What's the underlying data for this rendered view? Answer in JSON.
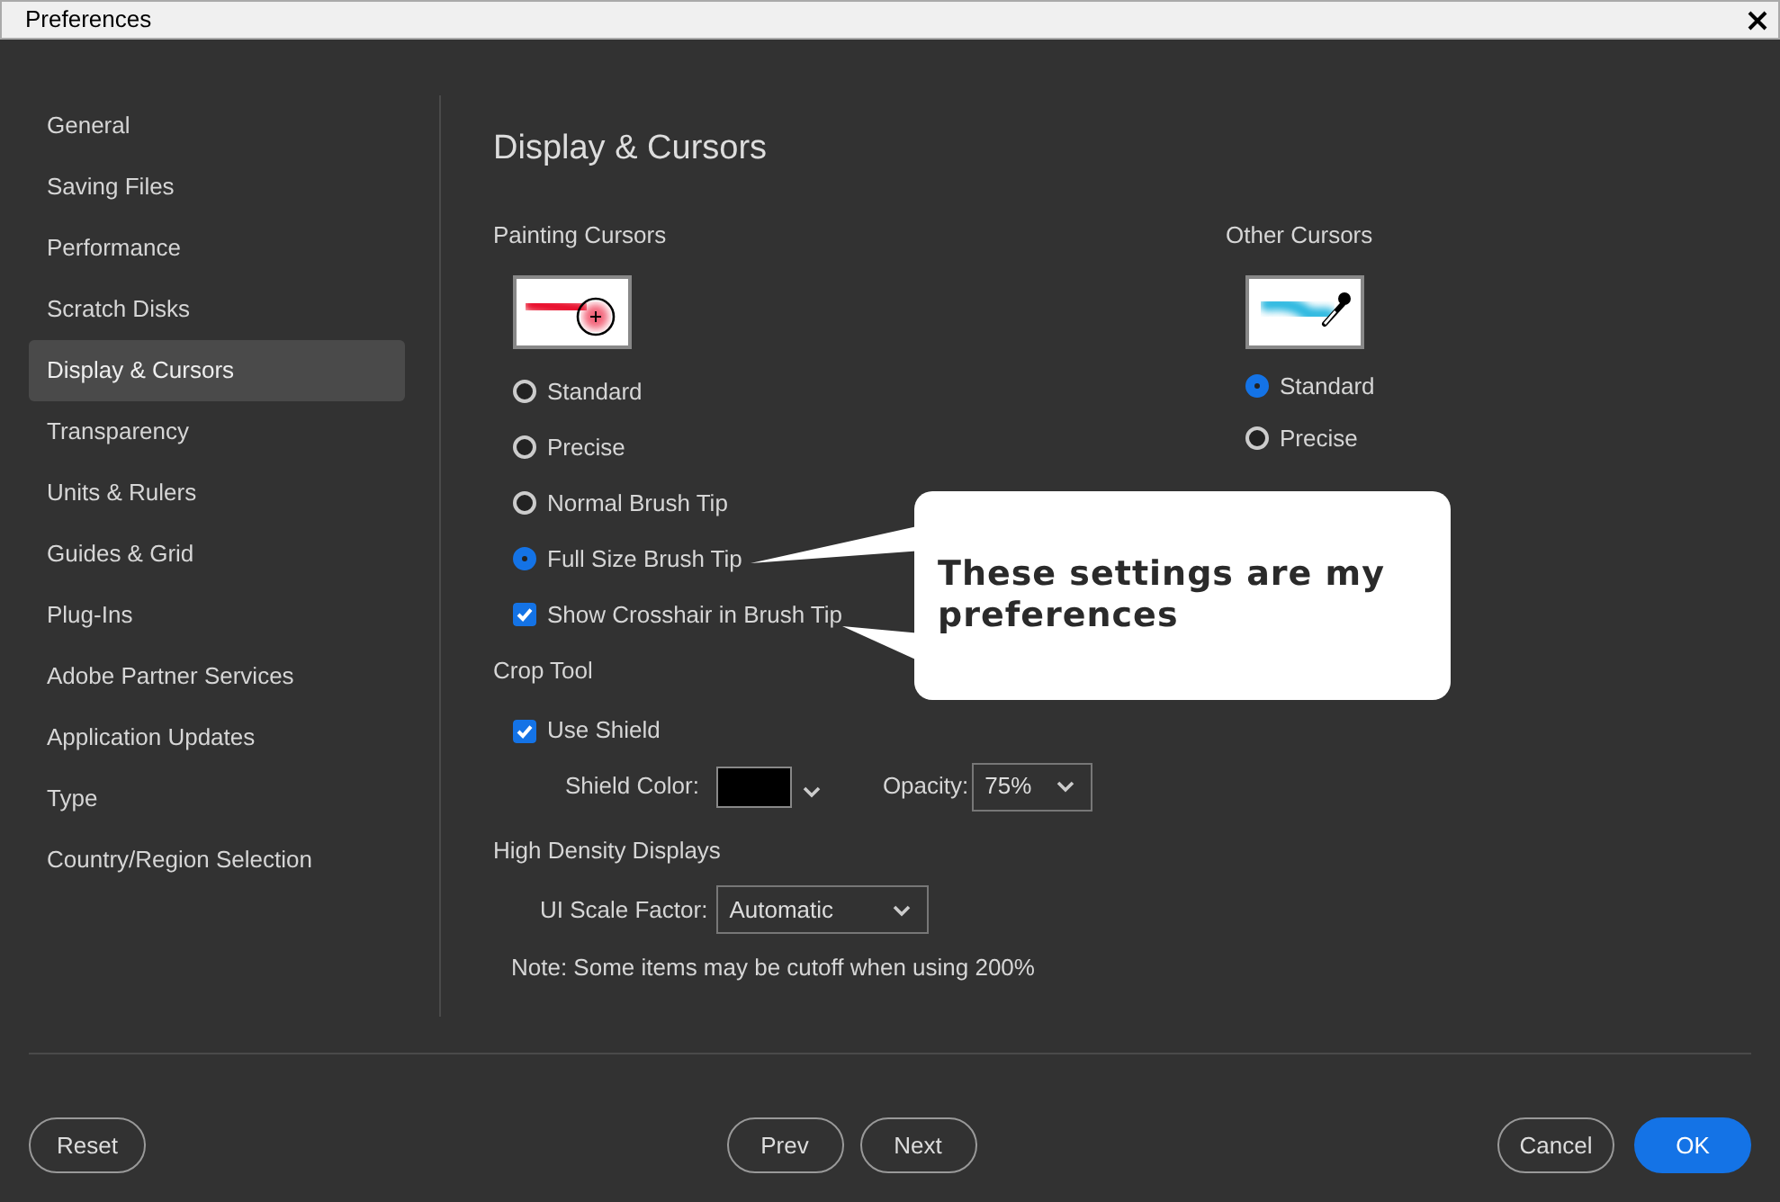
{
  "window": {
    "title": "Preferences"
  },
  "sidebar": {
    "items": [
      {
        "label": "General",
        "selected": false
      },
      {
        "label": "Saving Files",
        "selected": false
      },
      {
        "label": "Performance",
        "selected": false
      },
      {
        "label": "Scratch Disks",
        "selected": false
      },
      {
        "label": "Display & Cursors",
        "selected": true
      },
      {
        "label": "Transparency",
        "selected": false
      },
      {
        "label": "Units & Rulers",
        "selected": false
      },
      {
        "label": "Guides & Grid",
        "selected": false
      },
      {
        "label": "Plug-Ins",
        "selected": false
      },
      {
        "label": "Adobe Partner Services",
        "selected": false
      },
      {
        "label": "Application Updates",
        "selected": false
      },
      {
        "label": "Type",
        "selected": false
      },
      {
        "label": "Country/Region Selection",
        "selected": false
      }
    ]
  },
  "page_title": "Display & Cursors",
  "painting_cursors": {
    "label": "Painting Cursors",
    "options": [
      {
        "label": "Standard",
        "selected": false
      },
      {
        "label": "Precise",
        "selected": false
      },
      {
        "label": "Normal Brush Tip",
        "selected": false
      },
      {
        "label": "Full Size Brush Tip",
        "selected": true
      }
    ],
    "show_crosshair": {
      "label": "Show Crosshair in Brush Tip",
      "checked": true
    }
  },
  "other_cursors": {
    "label": "Other Cursors",
    "options": [
      {
        "label": "Standard",
        "selected": true
      },
      {
        "label": "Precise",
        "selected": false
      }
    ]
  },
  "crop_tool": {
    "label": "Crop Tool",
    "use_shield": {
      "label": "Use Shield",
      "checked": true
    },
    "shield_color": {
      "label": "Shield Color:",
      "color": "#000000"
    },
    "opacity": {
      "label": "Opacity:",
      "value": "75%"
    }
  },
  "high_density": {
    "label": "High Density Displays",
    "ui_scale": {
      "label": "UI Scale Factor:",
      "value": "Automatic"
    },
    "note": "Note: Some items may be cutoff when using 200%"
  },
  "callout": {
    "text": "These settings are my preferences"
  },
  "footer": {
    "left": [
      {
        "label": "Reset",
        "primary": false
      }
    ],
    "center": [
      {
        "label": "Prev",
        "primary": false
      },
      {
        "label": "Next",
        "primary": false
      }
    ],
    "right": [
      {
        "label": "Cancel",
        "primary": false
      },
      {
        "label": "OK",
        "primary": true
      }
    ]
  }
}
